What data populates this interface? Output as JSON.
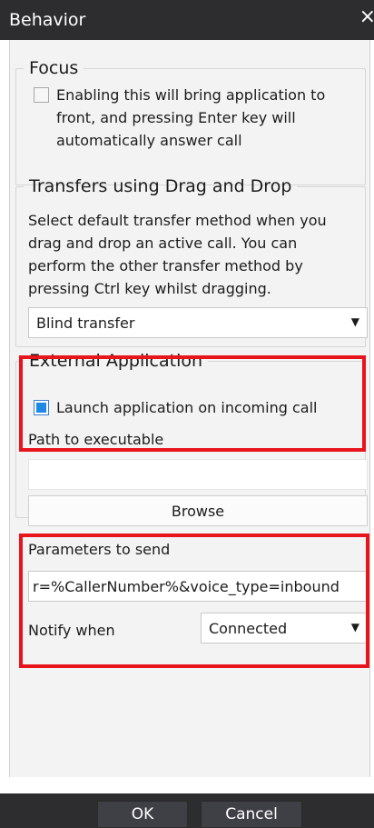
{
  "window": {
    "title": "Behavior",
    "close_icon": "×"
  },
  "focus": {
    "legend": "Focus",
    "checkbox_checked": false,
    "checkbox_label_line1": "Enabling this will bring application to",
    "checkbox_label_line2": "front, and pressing Enter key will",
    "checkbox_label_line3": "automatically answer call"
  },
  "transfers": {
    "legend": "Transfers using Drag and Drop",
    "description_line1": "Select default transfer method when you",
    "description_line2": "drag and drop an active call. You can",
    "description_line3": "perform the other transfer method by",
    "description_line4": "pressing Ctrl key whilst dragging.",
    "method_selected": "Blind transfer"
  },
  "external_app": {
    "legend": "External Application",
    "launch_checked": true,
    "launch_label": "Launch application on incoming call",
    "path_label": "Path to executable",
    "path_value": "",
    "browse_label": "Browse",
    "params_label": "Parameters to send",
    "params_value": "r=%CallerNumber%&voice_type=inbound",
    "notify_label": "Notify when",
    "notify_selected": "Connected"
  },
  "footer": {
    "ok_label": "OK",
    "cancel_label": "Cancel"
  },
  "colors": {
    "titlebar": "#2d2d30",
    "highlight": "#e8141c",
    "checkbox_accent": "#1e88e5"
  }
}
